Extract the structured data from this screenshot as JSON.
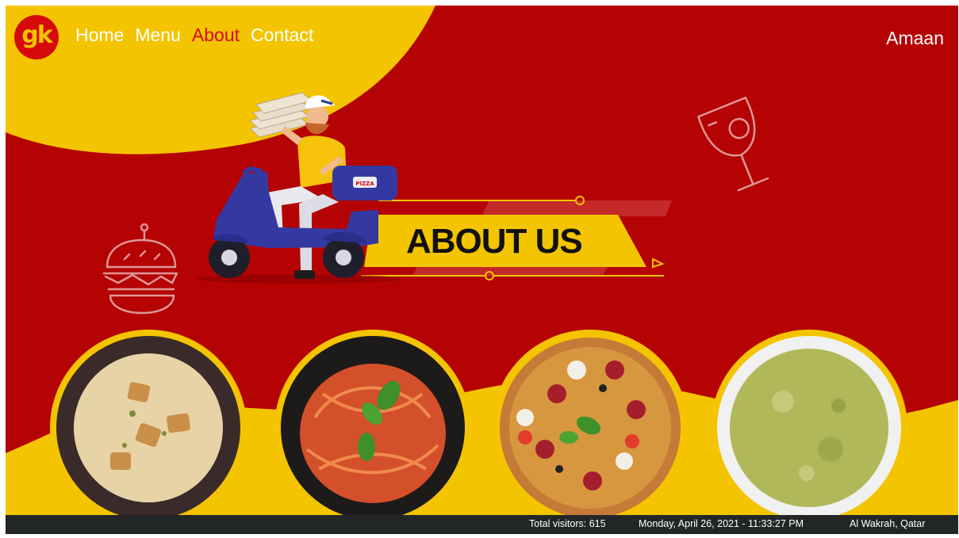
{
  "header": {
    "logo_text": "gk",
    "nav": [
      {
        "label": "Home",
        "active": false
      },
      {
        "label": "Menu",
        "active": false
      },
      {
        "label": "About",
        "active": true
      },
      {
        "label": "Contact",
        "active": false
      }
    ],
    "user_name": "Amaan"
  },
  "hero": {
    "title": "ABOUT US",
    "box_label": "PIZZA",
    "decor_icons": [
      "burger-icon",
      "wine-glass-icon"
    ]
  },
  "dishes": [
    {
      "name": "cream-soup",
      "icon": "soup-bowl"
    },
    {
      "name": "spaghetti",
      "icon": "pasta-plate"
    },
    {
      "name": "pizza",
      "icon": "pizza"
    },
    {
      "name": "green-soup",
      "icon": "soup-bowl"
    }
  ],
  "footer": {
    "visitors": "Total visitors: 615",
    "datetime": "Monday, April 26, 2021 - 11:33:27 PM",
    "location": "Al Wakrah, Qatar"
  },
  "colors": {
    "primary_red": "#b50303",
    "accent_yellow": "#f4c400",
    "active_link": "#d40b0b",
    "footer_bg": "#222627"
  }
}
